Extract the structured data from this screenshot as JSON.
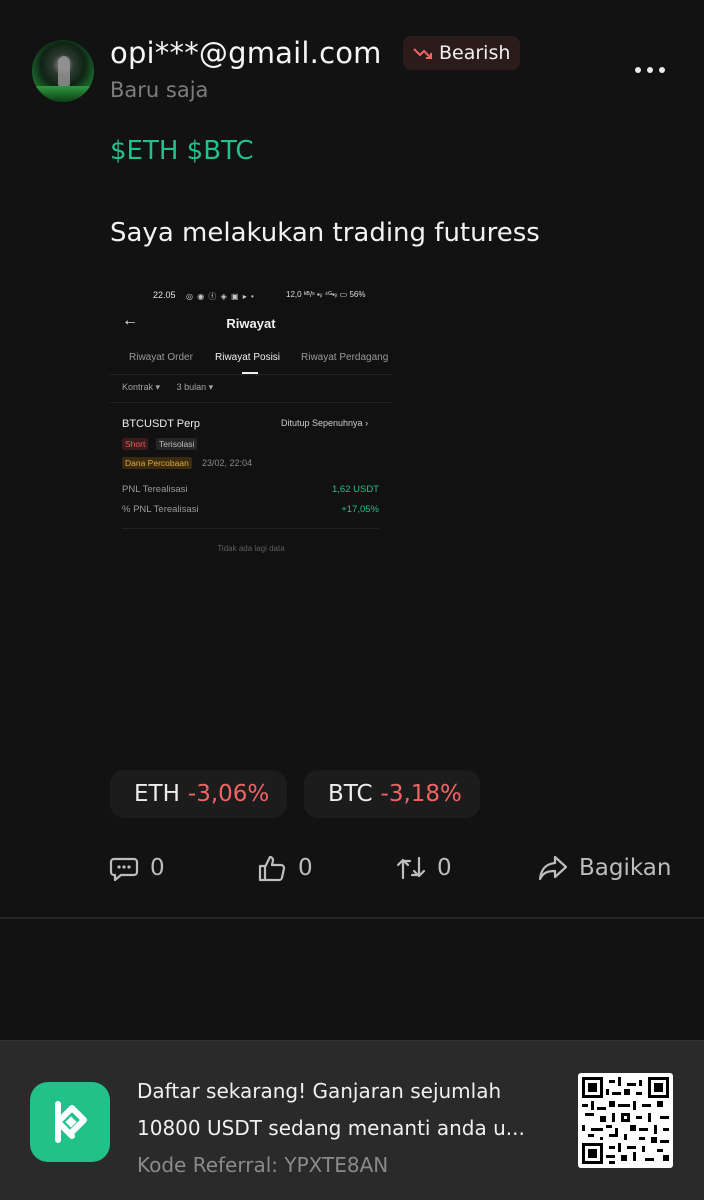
{
  "post": {
    "username": "opi***@gmail.com",
    "time": "Baru saja",
    "sentiment": {
      "label": "Bearish",
      "icon": "trend-down-icon",
      "color": "#f26464"
    },
    "tags": "$ETH $BTC",
    "content": "Saya melakukan trading futuress"
  },
  "screenshot": {
    "status_time": "22.05",
    "status_right": "12,0 ᵏᴮ/ˢ ▪ᵢₗ ⁴ᴳ▪ᵢₗ ▭ 56%",
    "title": "Riwayat",
    "tabs": [
      {
        "label": "Riwayat Order"
      },
      {
        "label": "Riwayat Posisi"
      },
      {
        "label": "Riwayat Perdagang"
      }
    ],
    "filters": [
      "Kontrak ▾",
      "3 bulan ▾"
    ],
    "position": {
      "pair": "BTCUSDT Perp",
      "status": "Ditutup Sepenuhnya ›",
      "side": "Short",
      "mode": "Terisolasi",
      "tag": "Dana Percobaan",
      "date": "23/02, 22:04",
      "pnl_label": "PNL Terealisasi",
      "pnl_value": "1,62 USDT",
      "pnl_pct_label": "% PNL Terealisasi",
      "pnl_pct_value": "+17,05%"
    },
    "empty_text": "Tidak ada lagi data"
  },
  "prices": [
    {
      "symbol": "ETH",
      "change": "-3,06%"
    },
    {
      "symbol": "BTC",
      "change": "-3,18%"
    }
  ],
  "actions": {
    "comments": "0",
    "likes": "0",
    "reposts": "0",
    "share_label": "Bagikan"
  },
  "banner": {
    "line1": "Daftar sekarang! Ganjaran sejumlah",
    "line2": "10800 USDT sedang menanti anda u...",
    "referral": "Kode Referral: YPXTE8AN",
    "brand_color": "#23c18a"
  },
  "colors": {
    "accent_green": "#23c18a",
    "negative_red": "#f26464",
    "background": "#121212"
  }
}
